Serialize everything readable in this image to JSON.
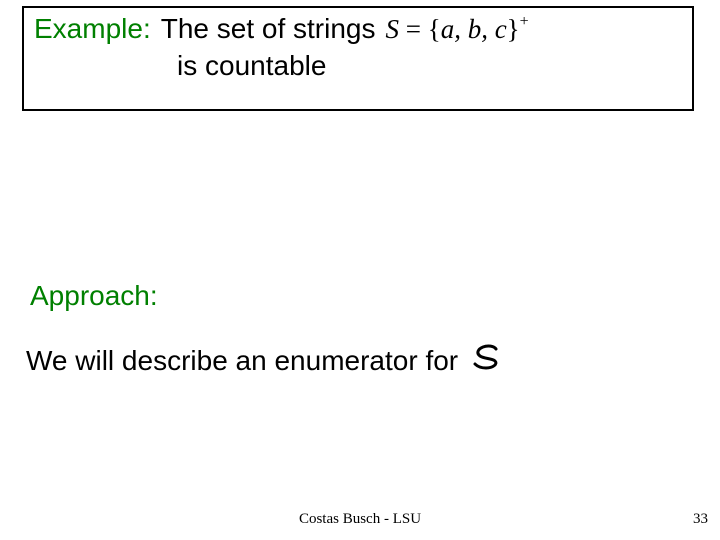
{
  "box": {
    "example_label": "Example:",
    "line1_text": "The set of strings",
    "set_lhs": "S",
    "set_eq": " = ",
    "set_open": "{",
    "set_items": "a, b, c",
    "set_close": "}",
    "set_sup": "+",
    "line2_text": "is countable"
  },
  "approach_label": "Approach:",
  "body_text": "We will describe an enumerator for",
  "body_symbol": "S",
  "footer": "Costas Busch - LSU",
  "page_number": "33"
}
